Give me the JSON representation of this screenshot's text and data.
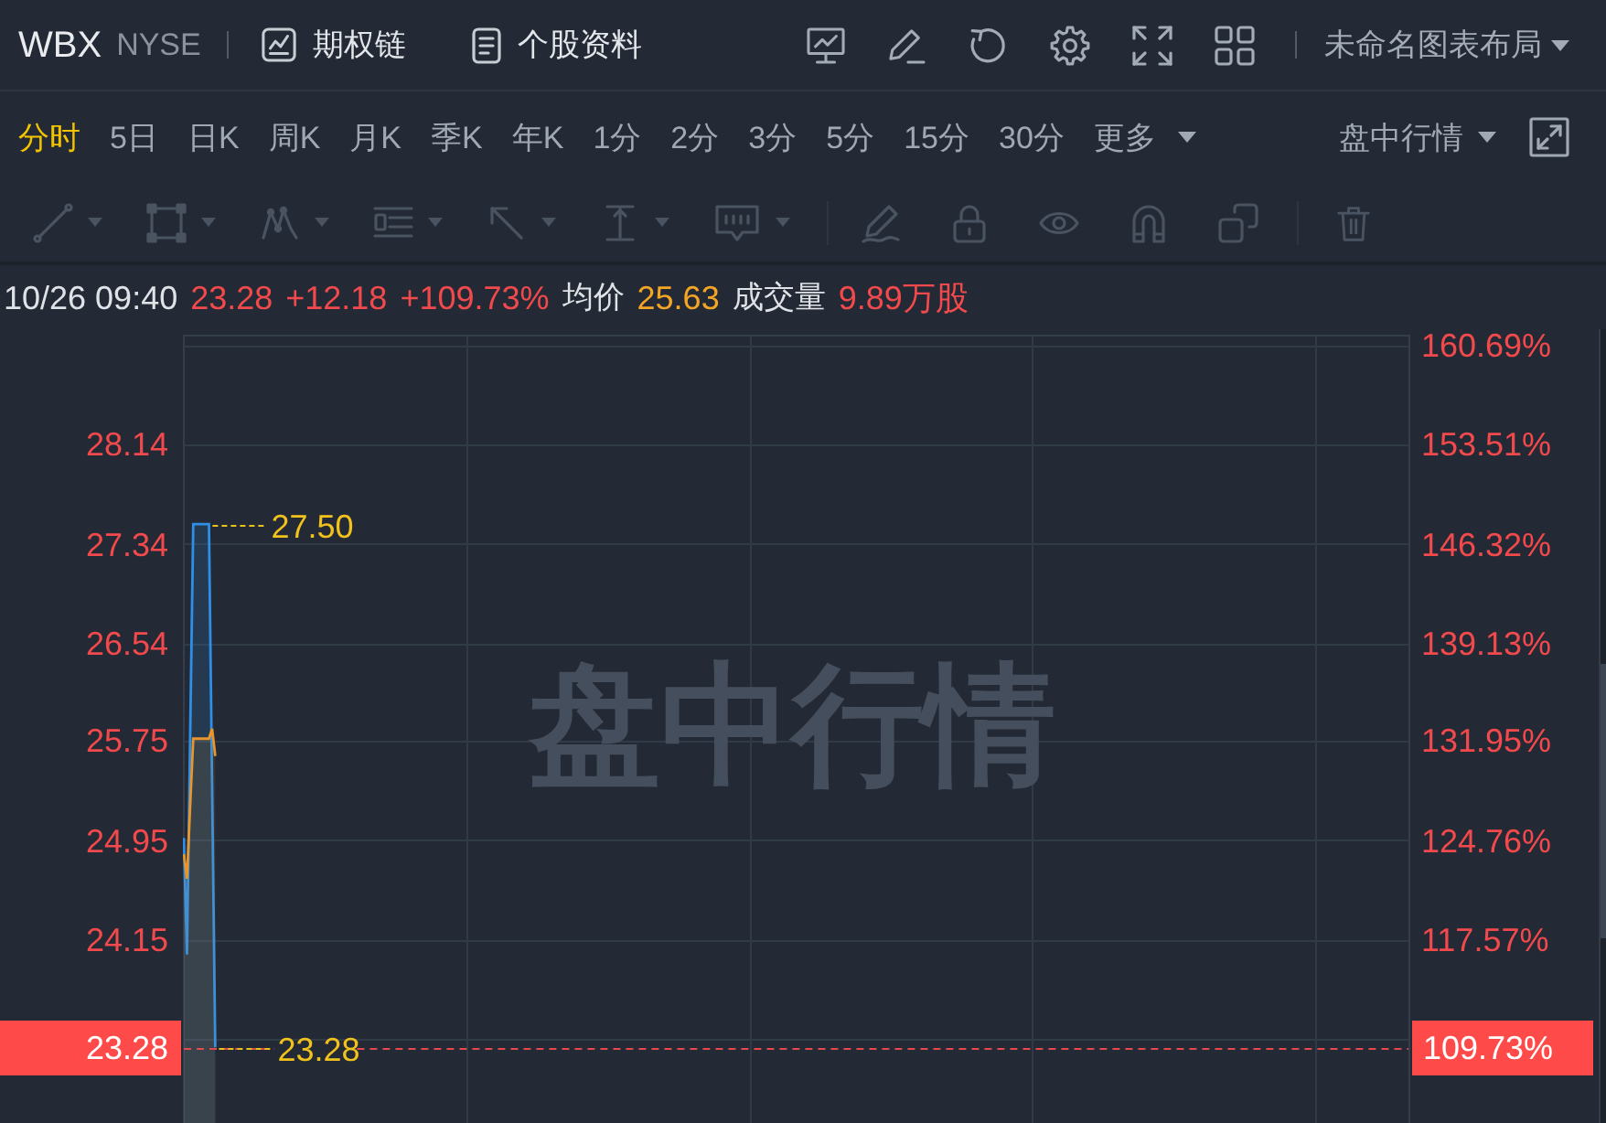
{
  "header": {
    "symbol": "WBX",
    "exchange": "NYSE",
    "links": [
      {
        "label": "期权链"
      },
      {
        "label": "个股资料"
      }
    ],
    "layout_menu": {
      "label": "未命名图表布局"
    }
  },
  "timeframes": [
    {
      "label": "分时",
      "selected": true
    },
    {
      "label": "5日",
      "selected": false
    },
    {
      "label": "日K",
      "selected": false
    },
    {
      "label": "周K",
      "selected": false
    },
    {
      "label": "月K",
      "selected": false
    },
    {
      "label": "季K",
      "selected": false
    },
    {
      "label": "年K",
      "selected": false
    },
    {
      "label": "1分",
      "selected": false
    },
    {
      "label": "2分",
      "selected": false
    },
    {
      "label": "3分",
      "selected": false
    },
    {
      "label": "5分",
      "selected": false
    },
    {
      "label": "15分",
      "selected": false
    },
    {
      "label": "30分",
      "selected": false
    }
  ],
  "more_menu": {
    "label": "更多"
  },
  "session_menu": {
    "label": "盘中行情"
  },
  "quote": {
    "time": "10/26 09:40",
    "price": "23.28",
    "change": "+12.18",
    "change_percent": "+109.73%",
    "avg_label": "均价",
    "avg": "25.63",
    "volume_label": "成交量",
    "volume": "9.89万股"
  },
  "chart": {
    "background_label": "盘中行情",
    "price_tag": "23.28",
    "percent_tag": "109.73%",
    "percent_axis": [
      "160.69%",
      "153.51%",
      "146.32%",
      "139.13%",
      "131.95%",
      "124.76%",
      "117.57%"
    ],
    "chart_data": {
      "type": "area",
      "grid": true,
      "ylim": [
        22.67,
        28.94
      ],
      "yticks": [
        {
          "value": 28.14,
          "label": "28.14"
        },
        {
          "value": 27.34,
          "label": "27.34"
        },
        {
          "value": 26.54,
          "label": "26.54"
        },
        {
          "value": 25.75,
          "label": "25.75"
        },
        {
          "value": 24.95,
          "label": "24.95"
        },
        {
          "value": 24.15,
          "label": "24.15"
        }
      ],
      "annotations": [
        "27.50",
        "23.28"
      ],
      "ref_lines": [
        {
          "axis": "y",
          "value": 23.28,
          "color": "#e5484d"
        }
      ],
      "categories": [
        null,
        null,
        null,
        null,
        null,
        null,
        null,
        null,
        null,
        null,
        null,
        null,
        null,
        null,
        null,
        null,
        null,
        null,
        null,
        null,
        null,
        null,
        null,
        null,
        null,
        null,
        null,
        null,
        null,
        null,
        null,
        null,
        null,
        null,
        null,
        null,
        null,
        null,
        null,
        null,
        null,
        null,
        null,
        null,
        null,
        null,
        null,
        null,
        null,
        null,
        null,
        null,
        null,
        null,
        null,
        null,
        null,
        null,
        null,
        null,
        null,
        null,
        null,
        null,
        null,
        null,
        null,
        null,
        null,
        null,
        null,
        null,
        null,
        null,
        null,
        null,
        null,
        null,
        null,
        null,
        null,
        null,
        null,
        null,
        null,
        null,
        null,
        null,
        null,
        null,
        null,
        null,
        null,
        null,
        null,
        null,
        null,
        null,
        null,
        null,
        null,
        null,
        null,
        null,
        null,
        null,
        null,
        null,
        null,
        null,
        null,
        null,
        null,
        null,
        null,
        null,
        null,
        null,
        null,
        null,
        null,
        null,
        null,
        null,
        null,
        null,
        null,
        null,
        null,
        null,
        null,
        null,
        null,
        null,
        null,
        null,
        null,
        null,
        null,
        null,
        null,
        null,
        null,
        null,
        null,
        null,
        null,
        null,
        null,
        null,
        null,
        null,
        null,
        null,
        null,
        null,
        null,
        null,
        null,
        null,
        null,
        null,
        null,
        null,
        null,
        null,
        null,
        null,
        null,
        null,
        null,
        null,
        null,
        null,
        null,
        null,
        null,
        null,
        null,
        null,
        null,
        null,
        null,
        null,
        null,
        null,
        null,
        null,
        null,
        null,
        null,
        null,
        null,
        null,
        null,
        null,
        null,
        null,
        null,
        null,
        null,
        null,
        null,
        null,
        null,
        null,
        null,
        null,
        null,
        null,
        null,
        null,
        null,
        null,
        null,
        null,
        null,
        null,
        null,
        null,
        null,
        null,
        null,
        null,
        null,
        null,
        null,
        null,
        null,
        null,
        null,
        null,
        null,
        null,
        null,
        null,
        null,
        null,
        null,
        null,
        null,
        null,
        null,
        null,
        null,
        null,
        null,
        null,
        null,
        null,
        null,
        null,
        null,
        null,
        null,
        null,
        null,
        null,
        null,
        null,
        null,
        null,
        null,
        null,
        null,
        null,
        null,
        null,
        null,
        null,
        null,
        null,
        null,
        null,
        null,
        null,
        null,
        null,
        null,
        null,
        null,
        null,
        null,
        null,
        null,
        null,
        null,
        null,
        null,
        null,
        null,
        null,
        null,
        null,
        null,
        null,
        null,
        null,
        null,
        null,
        null,
        null,
        null,
        null,
        null,
        null,
        null,
        null,
        null,
        null,
        null,
        null,
        null,
        null,
        null,
        null,
        null,
        null,
        null,
        null,
        null,
        null,
        null,
        null,
        null,
        null,
        null,
        null,
        null,
        null,
        null,
        null,
        null,
        null,
        null,
        null,
        null,
        null,
        null,
        null,
        null,
        null,
        null,
        null,
        null,
        null,
        null,
        null,
        null,
        null,
        null,
        null,
        null,
        null,
        null,
        null,
        null,
        null,
        null,
        null,
        null,
        null,
        null,
        null,
        null,
        null,
        null,
        null,
        null,
        null,
        null,
        null,
        null,
        null,
        null,
        null,
        null,
        null,
        null,
        null,
        null,
        null,
        null,
        null,
        null,
        null,
        null,
        null,
        null,
        null,
        null
      ],
      "series": [
        {
          "color": "#2f8fe6",
          "values": [
            24.97,
            24.03,
            25.77,
            27.5,
            27.5,
            27.5,
            27.5,
            27.5,
            27.5,
            25.39,
            23.28,
            null,
            null,
            null,
            null,
            null,
            null,
            null,
            null,
            null,
            null,
            null,
            null,
            null,
            null,
            null,
            null,
            null,
            null,
            null,
            null,
            null,
            null,
            null,
            null,
            null,
            null,
            null,
            null,
            null,
            null,
            null,
            null,
            null,
            null,
            null,
            null,
            null,
            null,
            null,
            null,
            null,
            null,
            null,
            null,
            null,
            null,
            null,
            null,
            null,
            null,
            null,
            null,
            null,
            null,
            null,
            null,
            null,
            null,
            null,
            null,
            null,
            null,
            null,
            null,
            null,
            null,
            null,
            null,
            null,
            null,
            null,
            null,
            null,
            null,
            null,
            null,
            null,
            null,
            null,
            null,
            null,
            null,
            null,
            null,
            null,
            null,
            null,
            null,
            null,
            null,
            null,
            null,
            null,
            null,
            null,
            null,
            null,
            null,
            null,
            null,
            null,
            null,
            null,
            null,
            null,
            null,
            null,
            null,
            null,
            null,
            null,
            null,
            null,
            null,
            null,
            null,
            null,
            null,
            null,
            null,
            null,
            null,
            null,
            null,
            null,
            null,
            null,
            null,
            null,
            null,
            null,
            null,
            null,
            null,
            null,
            null,
            null,
            null,
            null,
            null,
            null,
            null,
            null,
            null,
            null,
            null,
            null,
            null,
            null,
            null,
            null,
            null,
            null,
            null,
            null,
            null,
            null,
            null,
            null,
            null,
            null,
            null,
            null,
            null,
            null,
            null,
            null,
            null,
            null,
            null,
            null,
            null,
            null,
            null,
            null,
            null,
            null,
            null,
            null,
            null,
            null,
            null,
            null,
            null,
            null,
            null,
            null,
            null,
            null,
            null,
            null,
            null,
            null,
            null,
            null,
            null,
            null,
            null,
            null,
            null,
            null,
            null,
            null,
            null,
            null,
            null,
            null,
            null,
            null,
            null,
            null,
            null,
            null,
            null,
            null,
            null,
            null,
            null,
            null,
            null,
            null,
            null,
            null,
            null,
            null,
            null,
            null,
            null,
            null,
            null,
            null,
            null,
            null,
            null,
            null,
            null,
            null,
            null,
            null,
            null,
            null,
            null,
            null,
            null,
            null,
            null,
            null,
            null,
            null,
            null,
            null,
            null,
            null,
            null,
            null,
            null,
            null,
            null,
            null,
            null,
            null,
            null,
            null,
            null,
            null,
            null,
            null,
            null,
            null,
            null,
            null,
            null,
            null,
            null,
            null,
            null,
            null,
            null,
            null,
            null,
            null,
            null,
            null,
            null,
            null,
            null,
            null,
            null,
            null,
            null,
            null,
            null,
            null,
            null,
            null,
            null,
            null,
            null,
            null,
            null,
            null,
            null,
            null,
            null,
            null,
            null,
            null,
            null,
            null,
            null,
            null,
            null,
            null,
            null,
            null,
            null,
            null,
            null,
            null,
            null,
            null,
            null,
            null,
            null,
            null,
            null,
            null,
            null,
            null,
            null,
            null,
            null,
            null,
            null,
            null,
            null,
            null,
            null,
            null,
            null,
            null,
            null,
            null,
            null,
            null,
            null,
            null,
            null,
            null,
            null,
            null,
            null,
            null,
            null,
            null,
            null,
            null,
            null,
            null,
            null,
            null,
            null,
            null,
            null,
            null,
            null,
            null,
            null,
            null,
            null,
            null,
            null,
            null,
            null,
            null,
            null,
            null,
            null,
            null,
            null
          ]
        },
        {
          "color": "#e8952b",
          "values": [
            24.84,
            24.64,
            25.22,
            25.77,
            25.77,
            25.77,
            25.77,
            25.77,
            25.77,
            25.85,
            25.63,
            null,
            null,
            null,
            null,
            null,
            null,
            null,
            null,
            null,
            null,
            null,
            null,
            null,
            null,
            null,
            null,
            null,
            null,
            null,
            null,
            null,
            null,
            null,
            null,
            null,
            null,
            null,
            null,
            null,
            null,
            null,
            null,
            null,
            null,
            null,
            null,
            null,
            null,
            null,
            null,
            null,
            null,
            null,
            null,
            null,
            null,
            null,
            null,
            null,
            null,
            null,
            null,
            null,
            null,
            null,
            null,
            null,
            null,
            null,
            null,
            null,
            null,
            null,
            null,
            null,
            null,
            null,
            null,
            null,
            null,
            null,
            null,
            null,
            null,
            null,
            null,
            null,
            null,
            null,
            null,
            null,
            null,
            null,
            null,
            null,
            null,
            null,
            null,
            null,
            null,
            null,
            null,
            null,
            null,
            null,
            null,
            null,
            null,
            null,
            null,
            null,
            null,
            null,
            null,
            null,
            null,
            null,
            null,
            null,
            null,
            null,
            null,
            null,
            null,
            null,
            null,
            null,
            null,
            null,
            null,
            null,
            null,
            null,
            null,
            null,
            null,
            null,
            null,
            null,
            null,
            null,
            null,
            null,
            null,
            null,
            null,
            null,
            null,
            null,
            null,
            null,
            null,
            null,
            null,
            null,
            null,
            null,
            null,
            null,
            null,
            null,
            null,
            null,
            null,
            null,
            null,
            null,
            null,
            null,
            null,
            null,
            null,
            null,
            null,
            null,
            null,
            null,
            null,
            null,
            null,
            null,
            null,
            null,
            null,
            null,
            null,
            null,
            null,
            null,
            null,
            null,
            null,
            null,
            null,
            null,
            null,
            null,
            null,
            null,
            null,
            null,
            null,
            null,
            null,
            null,
            null,
            null,
            null,
            null,
            null,
            null,
            null,
            null,
            null,
            null,
            null,
            null,
            null,
            null,
            null,
            null,
            null,
            null,
            null,
            null,
            null,
            null,
            null,
            null,
            null,
            null,
            null,
            null,
            null,
            null,
            null,
            null,
            null,
            null,
            null,
            null,
            null,
            null,
            null,
            null,
            null,
            null,
            null,
            null,
            null,
            null,
            null,
            null,
            null,
            null,
            null,
            null,
            null,
            null,
            null,
            null,
            null,
            null,
            null,
            null,
            null,
            null,
            null,
            null,
            null,
            null,
            null,
            null,
            null,
            null,
            null,
            null,
            null,
            null,
            null,
            null,
            null,
            null,
            null,
            null,
            null,
            null,
            null,
            null,
            null,
            null,
            null,
            null,
            null,
            null,
            null,
            null,
            null,
            null,
            null,
            null,
            null,
            null,
            null,
            null,
            null,
            null,
            null,
            null,
            null,
            null,
            null,
            null,
            null,
            null,
            null,
            null,
            null,
            null,
            null,
            null,
            null,
            null,
            null,
            null,
            null,
            null,
            null,
            null,
            null,
            null,
            null,
            null,
            null,
            null,
            null,
            null,
            null,
            null,
            null,
            null,
            null,
            null,
            null,
            null,
            null,
            null,
            null,
            null,
            null,
            null,
            null,
            null,
            null,
            null,
            null,
            null,
            null,
            null,
            null,
            null,
            null,
            null,
            null,
            null,
            null,
            null,
            null,
            null,
            null,
            null,
            null,
            null,
            null,
            null,
            null,
            null,
            null,
            null,
            null,
            null,
            null,
            null,
            null,
            null,
            null,
            null,
            null,
            null,
            null
          ]
        }
      ]
    }
  }
}
